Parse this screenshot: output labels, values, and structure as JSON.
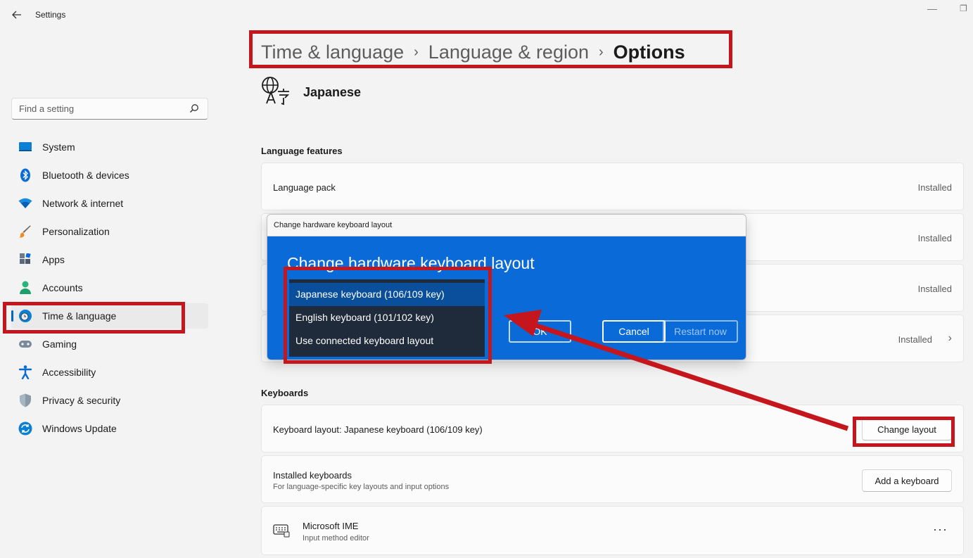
{
  "window": {
    "app_title": "Settings",
    "back_icon": "back-arrow-icon",
    "minimize_glyph": "—",
    "restore_glyph": "❐"
  },
  "breadcrumb": {
    "items": [
      "Time & language",
      "Language & region"
    ],
    "current": "Options",
    "separator": "›"
  },
  "language": {
    "name": "Japanese",
    "icon": "language-icon"
  },
  "search": {
    "placeholder": "Find a setting"
  },
  "sidebar": {
    "items": [
      {
        "label": "System",
        "icon": "system-icon"
      },
      {
        "label": "Bluetooth & devices",
        "icon": "bluetooth-icon"
      },
      {
        "label": "Network & internet",
        "icon": "wifi-icon"
      },
      {
        "label": "Personalization",
        "icon": "brush-icon"
      },
      {
        "label": "Apps",
        "icon": "apps-icon"
      },
      {
        "label": "Accounts",
        "icon": "accounts-icon"
      },
      {
        "label": "Time & language",
        "icon": "time-language-icon",
        "active": true
      },
      {
        "label": "Gaming",
        "icon": "gamepad-icon"
      },
      {
        "label": "Accessibility",
        "icon": "accessibility-icon"
      },
      {
        "label": "Privacy & security",
        "icon": "shield-icon"
      },
      {
        "label": "Windows Update",
        "icon": "update-icon"
      }
    ]
  },
  "language_features": {
    "title": "Language features",
    "rows": [
      {
        "label": "Language pack",
        "status": "Installed"
      },
      {
        "label": "",
        "status": "Installed"
      },
      {
        "label": "",
        "status": "Installed"
      },
      {
        "label": "",
        "status": "Installed"
      }
    ]
  },
  "keyboards": {
    "title": "Keyboards",
    "layout_label": "Keyboard layout: Japanese keyboard (106/109 key)",
    "change_layout_button": "Change layout",
    "installed_title": "Installed keyboards",
    "installed_subtitle": "For language-specific key layouts and input options",
    "add_keyboard_button": "Add a keyboard",
    "ime_name": "Microsoft IME",
    "ime_desc": "Input method editor",
    "more_glyph": "···"
  },
  "dialog": {
    "window_title": "Change hardware keyboard layout",
    "heading": "Change hardware keyboard layout",
    "ok_label": "OK",
    "cancel_label": "Cancel",
    "restart_label": "Restart now",
    "options": [
      "Japanese keyboard (106/109 key)",
      "English keyboard (101/102 key)",
      "Use connected keyboard layout"
    ],
    "selected_index": 0
  },
  "colors": {
    "accent": "#0067c0",
    "dialog_blue": "#0a6bd8",
    "highlight_red": "#c4161c",
    "dropdown_bg": "#1f2a3a"
  }
}
